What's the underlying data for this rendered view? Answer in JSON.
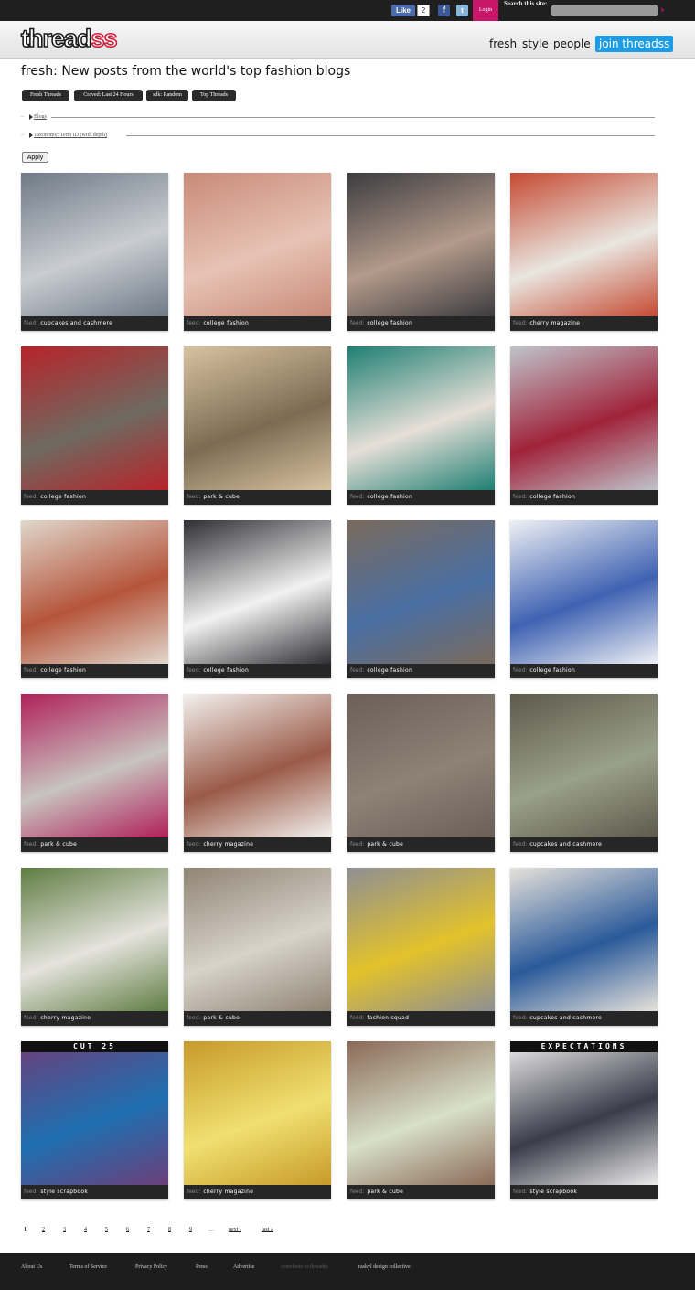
{
  "topbar": {
    "like_label": "Like",
    "like_count": "2",
    "login_label": "Login",
    "search_label": "Search this site:",
    "search_value": "",
    "search_go": "›"
  },
  "header": {
    "logo_main": "thread",
    "logo_accent": "ss",
    "nav": [
      "fresh",
      "style",
      "people"
    ],
    "join_label": "join threadss"
  },
  "page": {
    "title": "fresh: New posts from the world's top fashion blogs"
  },
  "filters": [
    "Fresh Threads",
    "Craved: Last 24 Hours",
    "sdk: Random",
    "Top Threads"
  ],
  "facets": [
    "Blogs",
    "Taxonomy: Term ID (with depth)"
  ],
  "apply_label": "Apply",
  "feed_label": "feed:",
  "posts": [
    {
      "source": "cupcakes and cashmere"
    },
    {
      "source": "college fashion"
    },
    {
      "source": "college fashion"
    },
    {
      "source": "cherry magazine"
    },
    {
      "source": "college fashion"
    },
    {
      "source": "park & cube"
    },
    {
      "source": "college fashion"
    },
    {
      "source": "college fashion"
    },
    {
      "source": "college fashion"
    },
    {
      "source": "college fashion"
    },
    {
      "source": "college fashion"
    },
    {
      "source": "college fashion"
    },
    {
      "source": "park & cube"
    },
    {
      "source": "cherry magazine"
    },
    {
      "source": "park & cube"
    },
    {
      "source": "cupcakes and cashmere"
    },
    {
      "source": "cherry magazine"
    },
    {
      "source": "park & cube"
    },
    {
      "source": "fashion squad"
    },
    {
      "source": "cupcakes and cashmere"
    },
    {
      "source": "style scrapbook",
      "overlay": "CUT 25"
    },
    {
      "source": "cherry magazine"
    },
    {
      "source": "park & cube"
    },
    {
      "source": "style scrapbook",
      "overlay": "EXPECTATIONS"
    }
  ],
  "pagination": {
    "pages": [
      "1",
      "2",
      "3",
      "4",
      "5",
      "6",
      "7",
      "8",
      "9"
    ],
    "current": "1",
    "ellipsis": "…",
    "next": "next ›",
    "last": "last »"
  },
  "footer": [
    "About Us",
    "Terms of Service",
    "Privacy Policy",
    "Press",
    "Advertise",
    "contribute to threadss",
    "raskyl design collective"
  ]
}
